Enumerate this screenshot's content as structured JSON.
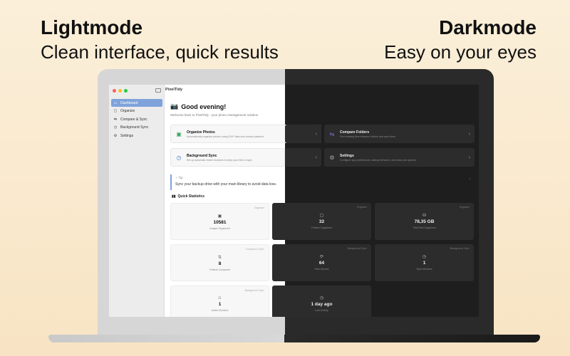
{
  "headline_left": {
    "title": "Lightmode",
    "subtitle": "Clean interface, quick results"
  },
  "headline_right": {
    "title": "Darkmode",
    "subtitle": "Easy on your eyes"
  },
  "app": {
    "title": "PixelTidy",
    "sidebar": [
      {
        "label": "Dashboard",
        "icon": "dashboard-icon",
        "glyph": "▭",
        "active": true
      },
      {
        "label": "Organize",
        "icon": "folder-icon",
        "glyph": "▢",
        "active": false
      },
      {
        "label": "Compare & Sync",
        "icon": "compare-icon",
        "glyph": "⇆",
        "active": false
      },
      {
        "label": "Background Sync",
        "icon": "clock-icon",
        "glyph": "◷",
        "active": false
      },
      {
        "label": "Settings",
        "icon": "gear-icon",
        "glyph": "⚙",
        "active": false
      }
    ],
    "greeting": "Good evening!",
    "welcome": "Welcome back to PixelTidy - your photo management solution",
    "cards": [
      {
        "title": "Organize Photos",
        "desc": "Automatically organize photos using EXIF data and custom patterns"
      },
      {
        "title": "Compare Folders",
        "desc": "Find missing files between folders and sync them"
      },
      {
        "title": "Background Sync",
        "desc": "Set up automatic folder monitors to keep your files in sync"
      },
      {
        "title": "Settings",
        "desc": "Configure app preferences, startup behavior, and menu bar options"
      }
    ],
    "tip": {
      "label": "Tip",
      "text": "Sync your backup drive with your main library to avoid data loss."
    },
    "quick_stats_title": "Quick Statistics",
    "stats": [
      {
        "category": "Organize",
        "value": "10581",
        "label": "Images Organized"
      },
      {
        "category": "Organize",
        "value": "32",
        "label": "Folders Organized"
      },
      {
        "category": "Organize",
        "value": "78,35 GB",
        "label": "Total Size Organized"
      },
      {
        "category": "Compare & Sync",
        "value": "8",
        "label": "Folders Compared"
      },
      {
        "category": "Background Sync",
        "value": "64",
        "label": "Files Synced"
      },
      {
        "category": "Background Sync",
        "value": "1",
        "label": "Sync Monitors"
      },
      {
        "category": "Background Sync",
        "value": "1",
        "label": "Active Monitors"
      },
      {
        "category": "",
        "value": "1 day ago",
        "label": "Last Activity"
      }
    ]
  },
  "colors": {
    "accent": "#7fa2da",
    "dark_bg": "#1e1e1e",
    "dark_card": "#2c2c2c",
    "light_card": "#f7f7f7"
  }
}
